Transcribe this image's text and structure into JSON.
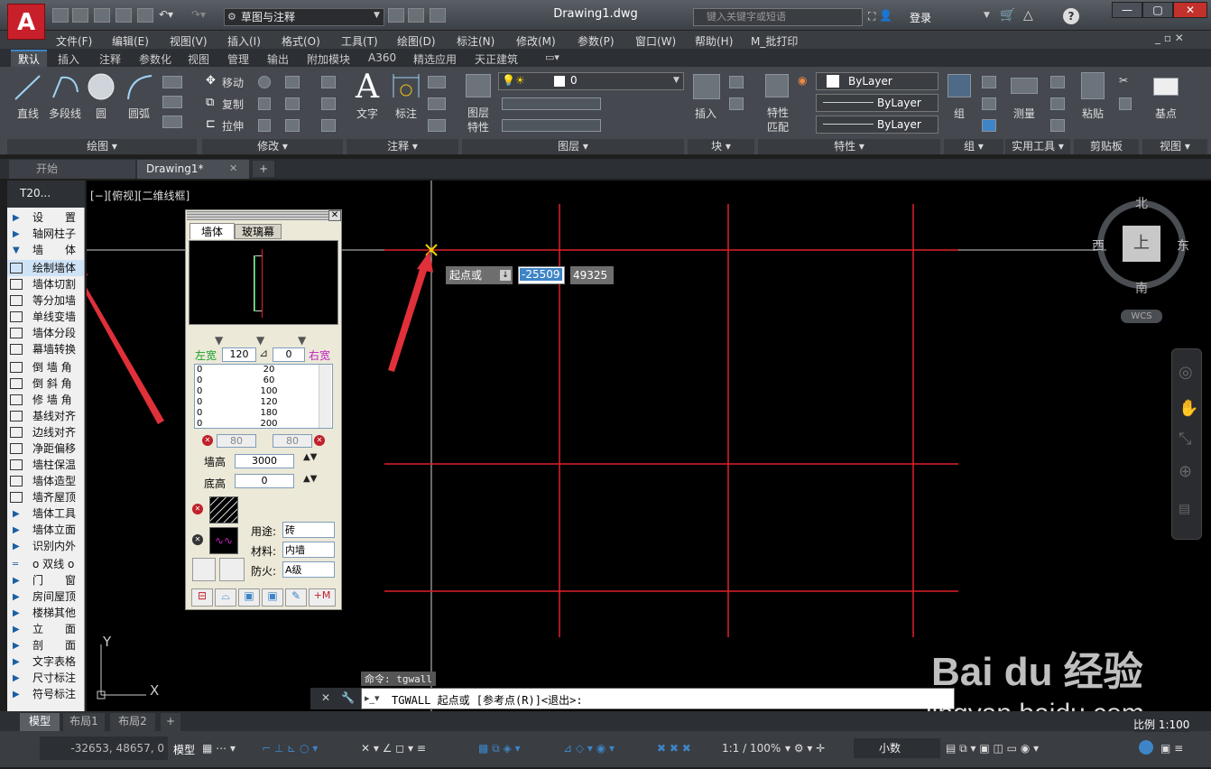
{
  "app": {
    "logo": "A",
    "doc_title": "Drawing1.dwg",
    "workspace": "草图与注释",
    "search_placeholder": "键入关键字或短语",
    "login": "登录"
  },
  "menu": [
    "文件(F)",
    "编辑(E)",
    "视图(V)",
    "插入(I)",
    "格式(O)",
    "工具(T)",
    "绘图(D)",
    "标注(N)",
    "修改(M)",
    "参数(P)",
    "窗口(W)",
    "帮助(H)",
    "M_批打印"
  ],
  "ribbon_tabs": [
    "默认",
    "插入",
    "注释",
    "参数化",
    "视图",
    "管理",
    "输出",
    "附加模块",
    "A360",
    "精选应用",
    "天正建筑"
  ],
  "ribbon": {
    "draw": {
      "line": "直线",
      "pline": "多段线",
      "circle": "圆",
      "arc": "圆弧",
      "panel": "绘图 ▾"
    },
    "modify": {
      "move": "移动",
      "copy": "复制",
      "stretch": "拉伸",
      "panel": "修改 ▾"
    },
    "annot": {
      "text": "文字",
      "dim": "标注",
      "panel": "注释 ▾"
    },
    "layer": {
      "props": "图层\n特性",
      "current": "0",
      "panel": "图层 ▾"
    },
    "block": {
      "insert": "插入",
      "panel": "块 ▾"
    },
    "props": {
      "match": "特性\n匹配",
      "bylayer1": "ByLayer",
      "bylayer2": "ByLayer",
      "bylayer3": "ByLayer",
      "panel": "特性 ▾"
    },
    "group": {
      "label": "组",
      "panel": "组 ▾"
    },
    "util": {
      "measure": "测量",
      "panel": "实用工具 ▾"
    },
    "clip": {
      "paste": "粘贴",
      "panel": "剪贴板"
    },
    "view": {
      "base": "基点",
      "panel": "视图 ▾"
    }
  },
  "file_tabs": {
    "start": "开始",
    "drawing": "Drawing1*"
  },
  "viewport_label": "[−][俯视][二维线框]",
  "t20": {
    "header": "T20...",
    "items": [
      "设　　置",
      "轴网柱子",
      "墙　　体",
      "绘制墙体",
      "墙体切割",
      "等分加墙",
      "单线变墙",
      "墙体分段",
      "幕墙转换",
      "倒 墙 角",
      "倒 斜 角",
      "修 墙 角",
      "基线对齐",
      "边线对齐",
      "净距偏移",
      "墙柱保温",
      "墙体造型",
      "墙齐屋顶",
      "墙体工具",
      "墙体立面",
      "识别内外",
      "o 双线 o",
      "门　　窗",
      "房间屋顶",
      "楼梯其他",
      "立　　面",
      "剖　　面",
      "文字表格",
      "尺寸标注",
      "符号标注"
    ]
  },
  "wall_panel": {
    "tabs": [
      "墙体",
      "玻璃幕"
    ],
    "left_width_label": "左宽",
    "left_width": "120",
    "right_width_label": "右宽",
    "right_val": "0",
    "widths": [
      [
        "0",
        "20"
      ],
      [
        "0",
        "60"
      ],
      [
        "0",
        "100"
      ],
      [
        "0",
        "120"
      ],
      [
        "0",
        "180"
      ],
      [
        "0",
        "200"
      ]
    ],
    "offset_left": "80",
    "offset_right": "80",
    "height_label": "墙高",
    "height": "3000",
    "base_label": "底高",
    "base": "0",
    "use_label": "用途:",
    "use": "砖",
    "material_label": "材料:",
    "material": "内墙",
    "fire_label": "防火:",
    "fire": "A级"
  },
  "dynamic_input": {
    "prompt": "起点或",
    "x": "-25509",
    "y": "49325"
  },
  "compass": {
    "n": "北",
    "s": "南",
    "e": "东",
    "w": "西",
    "top": "上",
    "wcs": "WCS"
  },
  "command": {
    "history": "命令: tgwall",
    "prompt": "TGWALL 起点或 [参考点(R)]<退出>:"
  },
  "layout_tabs": [
    "模型",
    "布局1",
    "布局2"
  ],
  "status": {
    "coords": "-32653, 48657, 0",
    "model": "模型",
    "scale": "1:1 / 100%",
    "units": "小数",
    "ratio": "比例 1:100"
  },
  "watermark": {
    "brand": "Bai du 经验",
    "url": "jingyan.baidu.com"
  },
  "colors": {
    "grid_red": "#e0202a",
    "bg": "#000000",
    "accent": "#3d85c6"
  }
}
